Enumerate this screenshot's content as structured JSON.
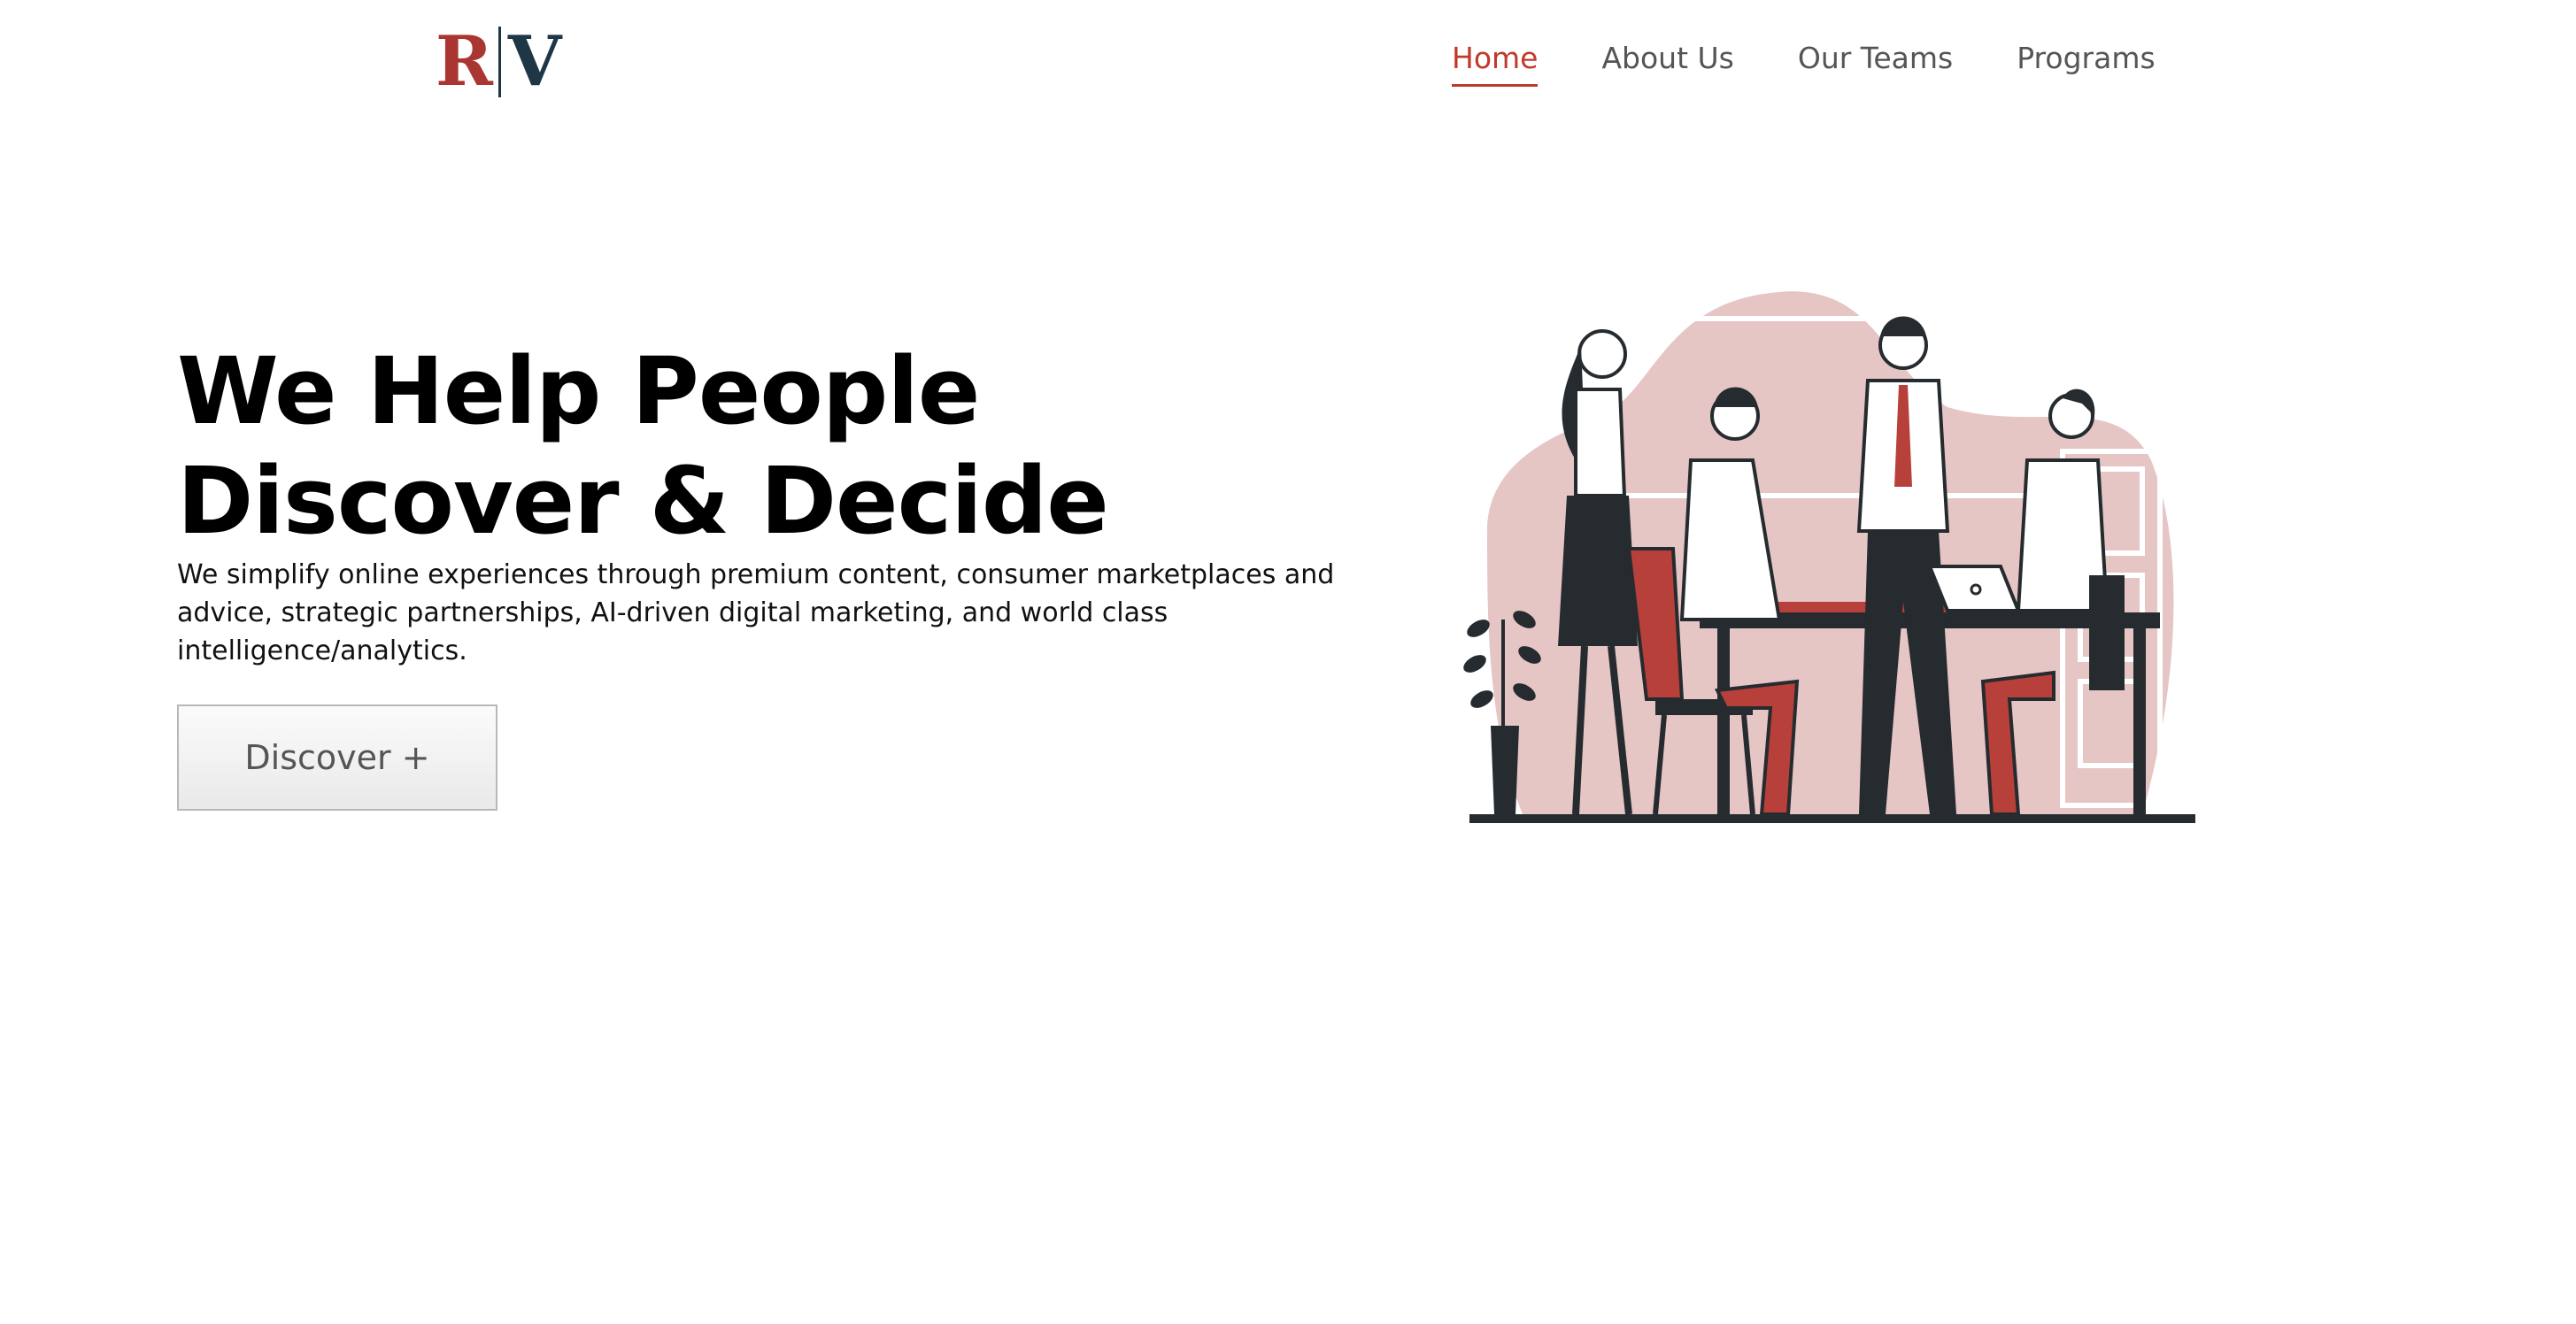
{
  "header": {
    "logo": {
      "left": "R",
      "right": "V"
    },
    "nav": [
      {
        "label": "Home"
      },
      {
        "label": "About Us"
      },
      {
        "label": "Our Teams"
      },
      {
        "label": "Programs"
      }
    ]
  },
  "hero": {
    "title": "We Help People Discover & Decide",
    "subtitle": "We simplify online experiences through premium content, consumer marketplaces and advice, strategic partnerships, AI-driven digital marketing, and world class intelligence/analytics.",
    "button_label": "Discover +"
  },
  "colors": {
    "accent": "#c0392b",
    "logo_red": "#a93630",
    "logo_navy": "#1f3646",
    "blob": "#e6c5c5",
    "dark": "#262b2f"
  },
  "icons": {
    "illustration": "team-meeting-illustration"
  }
}
